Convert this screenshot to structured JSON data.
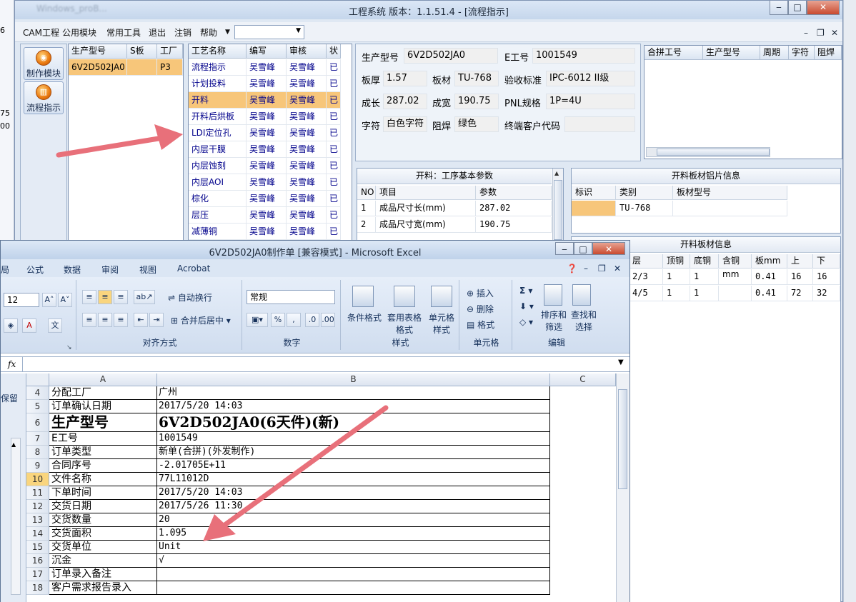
{
  "background": {
    "left_numbers": [
      "6",
      "75",
      "00"
    ],
    "right_tab": ""
  },
  "main": {
    "title": "工程系统  版本：1.1.51.4 - [流程指示]",
    "ghost_title": "Windows_proB...",
    "menu": [
      "CAM工程",
      "公用模块",
      "常用工具",
      "退出",
      "注销",
      "帮助"
    ],
    "menu_combo_value": "",
    "tool_buttons": [
      {
        "label": "制作模块",
        "icon": "gear-icon"
      },
      {
        "label": "流程指示",
        "icon": "flow-icon"
      }
    ],
    "product_grid": {
      "headers": [
        "生产型号",
        "S板",
        "工厂"
      ],
      "rows": [
        [
          "6V2D502JA0",
          "",
          "P3"
        ]
      ]
    },
    "process_grid": {
      "headers": [
        "工艺名称",
        "编写",
        "审核",
        "状"
      ],
      "rows": [
        [
          "流程指示",
          "吴雪峰",
          "吴雪峰",
          "已"
        ],
        [
          "计划投料",
          "吴雪峰",
          "吴雪峰",
          "已"
        ],
        [
          "开料",
          "吴雪峰",
          "吴雪峰",
          "已"
        ],
        [
          "开料后烘板",
          "吴雪峰",
          "吴雪峰",
          "已"
        ],
        [
          "LDI定位孔",
          "吴雪峰",
          "吴雪峰",
          "已"
        ],
        [
          "内层干膜",
          "吴雪峰",
          "吴雪峰",
          "已"
        ],
        [
          "内层蚀刻",
          "吴雪峰",
          "吴雪峰",
          "已"
        ],
        [
          "内层AOI",
          "吴雪峰",
          "吴雪峰",
          "已"
        ],
        [
          "棕化",
          "吴雪峰",
          "吴雪峰",
          "已"
        ],
        [
          "层压",
          "吴雪峰",
          "吴雪峰",
          "已"
        ],
        [
          "减薄铜",
          "吴雪峰",
          "吴雪峰",
          "已"
        ]
      ],
      "selected_index": 2
    },
    "info": {
      "product_label": "生产型号",
      "product_value": "6V2D502JA0",
      "e_label": "E工号",
      "e_value": "1001549",
      "thick_label": "板厚",
      "thick_value": "1.57",
      "mat_label": "板材",
      "mat_value": "TU-768",
      "std_label": "验收标准",
      "std_value": "IPC-6012 II级",
      "len_label": "成长",
      "len_value": "287.02",
      "wid_label": "成宽",
      "wid_value": "190.75",
      "pnl_label": "PNL规格",
      "pnl_value": "1P=4U",
      "char_label": "字符",
      "char_value": "白色字符",
      "mask_label": "阻焊",
      "mask_value": "绿色",
      "cust_label": "终端客户代码",
      "cust_value": ""
    },
    "merge_grid": {
      "headers": [
        "合拼工号",
        "生产型号",
        "周期",
        "字符",
        "阻焊"
      ]
    },
    "params_section": {
      "title": "开料：工序基本参数",
      "headers": [
        "NO",
        "项目",
        "参数"
      ],
      "rows": [
        [
          "1",
          "成品尺寸长(mm)",
          "287.02"
        ],
        [
          "2",
          "成品尺寸宽(mm)",
          "190.75"
        ]
      ]
    },
    "foil_section": {
      "title": "开料板材铝片信息",
      "headers": [
        "标识",
        "类别",
        "板材型号"
      ],
      "rows": [
        [
          "",
          "TU-768",
          ""
        ]
      ]
    },
    "board_section": {
      "title": "开料板材信息",
      "headers": [
        "层",
        "顶铜",
        "底铜",
        "含铜mm",
        "板mm",
        "上",
        "下"
      ],
      "rows": [
        [
          "2/3",
          "1",
          "1",
          "",
          "0.41",
          "16",
          "16"
        ],
        [
          "4/5",
          "1",
          "1",
          "",
          "0.41",
          "72",
          "32"
        ]
      ]
    }
  },
  "excel": {
    "title": "6V2D502JA0制作单  [兼容模式] - Microsoft Excel",
    "tabs": [
      "局",
      "公式",
      "数据",
      "审阅",
      "视图",
      "Acrobat"
    ],
    "font_size": "12",
    "wrap_label": "自动换行",
    "merge_label": "合并后居中",
    "number_format": "常规",
    "groups": {
      "align": "对齐方式",
      "number": "数字",
      "style": "样式",
      "cells": "单元格",
      "edit": "编辑"
    },
    "style_buttons": [
      "条件格式",
      "套用表格格式",
      "单元格样式"
    ],
    "cell_buttons": [
      "插入",
      "删除",
      "格式"
    ],
    "edit_buttons": [
      "排序和筛选",
      "查找和选择"
    ],
    "fx": "fx",
    "side_label": "保留",
    "columns": [
      "A",
      "B",
      "C"
    ],
    "rows": [
      {
        "n": "4",
        "a": "分配工厂",
        "b": "广州"
      },
      {
        "n": "5",
        "a": "订单确认日期",
        "b": "2017/5/20 14:03"
      },
      {
        "n": "6",
        "a": "生产型号",
        "b": "6V2D502JA0(6天件)(新)",
        "big": true
      },
      {
        "n": "7",
        "a": "E工号",
        "b": "1001549"
      },
      {
        "n": "8",
        "a": "订单类型",
        "b": "新单(合拼)(外发制作)"
      },
      {
        "n": "9",
        "a": "合同序号",
        "b": "-2.01705E+11"
      },
      {
        "n": "10",
        "a": "文件名称",
        "b": "77L11012D"
      },
      {
        "n": "11",
        "a": "下单时间",
        "b": "2017/5/20 14:03"
      },
      {
        "n": "12",
        "a": "交货日期",
        "b": "2017/5/26 11:30"
      },
      {
        "n": "13",
        "a": "交货数量",
        "b": "20"
      },
      {
        "n": "14",
        "a": "交货面积",
        "b": "1.095"
      },
      {
        "n": "15",
        "a": "交货单位",
        "b": "Unit"
      },
      {
        "n": "16",
        "a": "沉金",
        "b": "√"
      },
      {
        "n": "17",
        "a": "订单录入备注",
        "b": ""
      },
      {
        "n": "18",
        "a": "客户需求报告录入",
        "b": ""
      }
    ]
  },
  "colors": {
    "arrow": "#e8707a",
    "selected": "#f7c67a",
    "grid_text": "#00008b"
  }
}
